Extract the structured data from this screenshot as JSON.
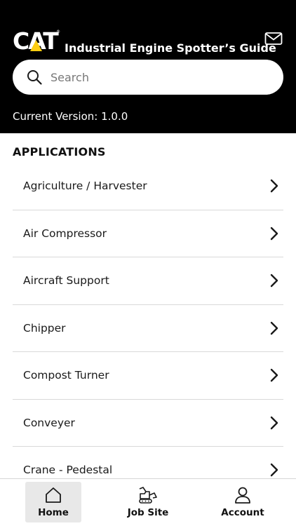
{
  "header": {
    "logo_text": "CAT",
    "title": "Industrial Engine Spotter’s Guide",
    "version_text": "Current Version: 1.0.0",
    "mail_icon": "mail-icon"
  },
  "search": {
    "placeholder": "Search",
    "value": "",
    "icon": "search-icon"
  },
  "section": {
    "title": "APPLICATIONS"
  },
  "applications": [
    {
      "label": "Agriculture / Harvester"
    },
    {
      "label": "Air Compressor"
    },
    {
      "label": "Aircraft Support"
    },
    {
      "label": "Chipper"
    },
    {
      "label": "Compost Turner"
    },
    {
      "label": "Conveyer"
    },
    {
      "label": "Crane - Pedestal"
    }
  ],
  "bottom_nav": {
    "items": [
      {
        "label": "Home",
        "icon": "home-icon",
        "active": true
      },
      {
        "label": "Job Site",
        "icon": "excavator-icon",
        "active": false
      },
      {
        "label": "Account",
        "icon": "person-icon",
        "active": false
      }
    ]
  },
  "colors": {
    "header_bg": "#000000",
    "logo_yellow": "#FFCD11",
    "active_nav_bg": "#e8e8e8",
    "divider": "#d9d9d9"
  }
}
